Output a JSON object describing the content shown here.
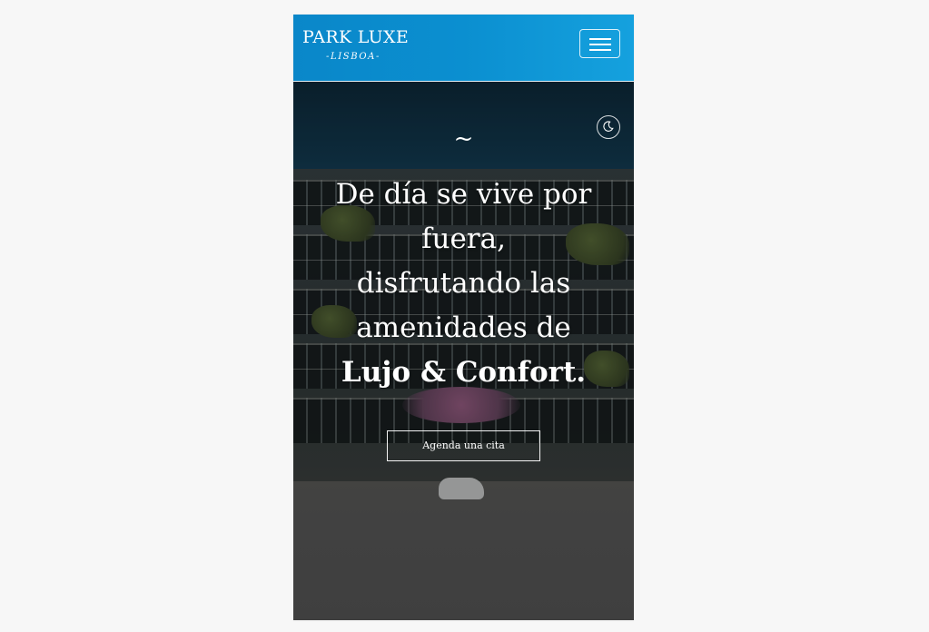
{
  "header": {
    "brand_name": "PARK LUXE",
    "brand_city": "-LISBOA-",
    "menu_icon": "hamburger-menu-icon"
  },
  "hero": {
    "night_mode_icon": "moon-icon",
    "ornament": "~",
    "headline_lines": [
      "De día se vive por",
      "fuera,",
      "disfrutando las",
      "amenidades de"
    ],
    "headline_emphasis": "Lujo & Confort.",
    "cta_label": "Agenda una cita"
  },
  "colors": {
    "header_gradient_start": "#0a87c9",
    "header_gradient_end": "#15a1de",
    "text": "#ffffff",
    "page_background": "#f7f7f7"
  }
}
